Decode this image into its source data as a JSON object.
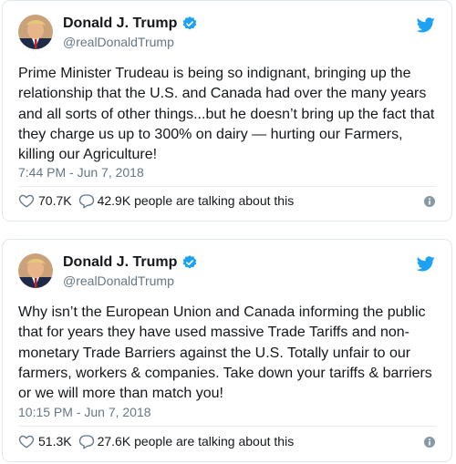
{
  "tweets": [
    {
      "author_name": "Donald J. Trump",
      "handle": "@realDonaldTrump",
      "text_lines": [
        "Prime Minister Trudeau is being so indignant, bringing up the",
        "relationship that the U.S. and Canada had over the many years",
        "and all sorts of other things...but he doesn’t bring up the fact that",
        "they charge us up to 300% on dairy — hurting our Farmers,",
        "killing our Agriculture!"
      ],
      "timestamp": "7:44 PM - Jun 7, 2018",
      "likes": "70.7K",
      "talking": "42.9K people are talking about this"
    },
    {
      "author_name": "Donald J. Trump",
      "handle": "@realDonaldTrump",
      "text_lines": [
        "Why isn’t the European Union and Canada informing the public",
        "that for years they have used massive Trade Tariffs and non-",
        "monetary Trade Barriers against the U.S. Totally unfair to our",
        "farmers, workers & companies. Take down your tariffs & barriers",
        "or we will more than match you!"
      ],
      "timestamp": "10:15 PM - Jun 7, 2018",
      "likes": "51.3K",
      "talking": "27.6K people are talking about this"
    }
  ],
  "icons": {
    "verified": "verified-badge-icon",
    "brand": "twitter-bird-icon",
    "like": "heart-icon",
    "reply": "speech-bubble-icon",
    "info": "info-icon"
  },
  "colors": {
    "brand_blue": "#1da1f2",
    "text": "#14171a",
    "muted": "#657786",
    "border": "#e1e8ed"
  }
}
